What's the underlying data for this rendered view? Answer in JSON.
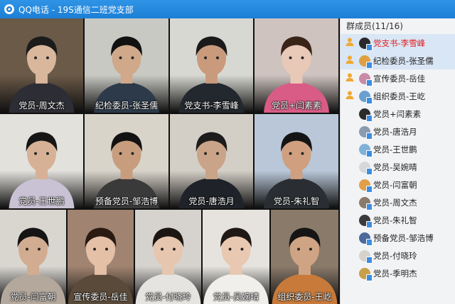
{
  "window": {
    "app": "QQ电话",
    "separator": "-",
    "group": "19S通信二班党支部"
  },
  "video_tiles": [
    {
      "label": "党员-周文杰",
      "bg": "#6b5a48",
      "skin": "#d9b79c",
      "hair": "#1b1b1b",
      "shirt": "#2d2d35"
    },
    {
      "label": "纪检委员-张圣儒",
      "bg": "#c9c9c4",
      "skin": "#cfa98a",
      "hair": "#111111",
      "shirt": "#2c3a4a"
    },
    {
      "label": "党支书-李雪峰",
      "bg": "#d8d8d2",
      "skin": "#c99a7c",
      "hair": "#1a1a1a",
      "shirt": "#23282e"
    },
    {
      "label": "党员+闫素素",
      "bg": "#cfc3bf",
      "skin": "#e8c9b8",
      "hair": "#3a2418",
      "shirt": "#d85c86"
    },
    {
      "label": "党员-王世鹏",
      "bg": "#e3e1dc",
      "skin": "#d6b196",
      "hair": "#161616",
      "shirt": "#c9c2d4"
    },
    {
      "label": "预备党员-邹浩博",
      "bg": "#d9d4ca",
      "skin": "#c79d7d",
      "hair": "#121212",
      "shirt": "#3a3a3a"
    },
    {
      "label": "党员-唐浩月",
      "bg": "#d4cfc6",
      "skin": "#caa488",
      "hair": "#1c1c1c",
      "shirt": "#1f2228"
    },
    {
      "label": "党员-朱礼智",
      "bg": "#b9c7d8",
      "skin": "#cf9f7f",
      "hair": "#141414",
      "shirt": "#2a2e33"
    },
    {
      "label": "党员-闫富朝",
      "bg": "#d9d6d0",
      "skin": "#d2ac90",
      "hair": "#151515",
      "shirt": "#b4a89c"
    },
    {
      "label": "宣传委员-岳佳",
      "bg": "#a08370",
      "skin": "#e3c0a6",
      "hair": "#2a1a12",
      "shirt": "#5a4a3a"
    },
    {
      "label": "党员-付晓玲",
      "bg": "#d6d3cf",
      "skin": "#e6c6ae",
      "hair": "#1c1612",
      "shirt": "#e6e4e0"
    },
    {
      "label": "党员-吴婉晴",
      "bg": "#e6e3de",
      "skin": "#e8c8b0",
      "hair": "#1f1814",
      "shirt": "#f1efeb"
    },
    {
      "label": "组织委员-王屹",
      "bg": "#8a7a6a",
      "skin": "#cfa484",
      "hair": "#151515",
      "shirt": "#c77a3a"
    }
  ],
  "members_panel": {
    "title": "群成员(11/16)",
    "members": [
      {
        "label": "党支书-李雪峰",
        "role_icon": "admin-icon",
        "avatar_color": "#2a2a2a",
        "leader": true,
        "selected": true
      },
      {
        "label": "纪检委员-张圣儒",
        "role_icon": "admin-icon",
        "avatar_color": "#e0a040",
        "leader": false,
        "selected": true
      },
      {
        "label": "宣传委员-岳佳",
        "role_icon": "admin-icon",
        "avatar_color": "#c98aa8",
        "leader": false,
        "selected": false
      },
      {
        "label": "组织委员-王屹",
        "role_icon": "admin-icon",
        "avatar_color": "#6aa0d0",
        "leader": false,
        "selected": false
      },
      {
        "label": "党员+闫素素",
        "role_icon": "",
        "avatar_color": "#2b2b2b",
        "leader": false,
        "selected": false
      },
      {
        "label": "党员-唐浩月",
        "role_icon": "",
        "avatar_color": "#8a9bb0",
        "leader": false,
        "selected": false
      },
      {
        "label": "党员-王世鹏",
        "role_icon": "",
        "avatar_color": "#7fb2d8",
        "leader": false,
        "selected": false
      },
      {
        "label": "党员-吴婉晴",
        "role_icon": "",
        "avatar_color": "#d8d8d8",
        "leader": false,
        "selected": false
      },
      {
        "label": "党员-闫富朝",
        "role_icon": "",
        "avatar_color": "#e0a048",
        "leader": false,
        "selected": false
      },
      {
        "label": "党员-周文杰",
        "role_icon": "",
        "avatar_color": "#8a7a6a",
        "leader": false,
        "selected": false
      },
      {
        "label": "党员-朱礼智",
        "role_icon": "",
        "avatar_color": "#3a3a3a",
        "leader": false,
        "selected": false
      },
      {
        "label": "预备党员-邹浩博",
        "role_icon": "",
        "avatar_color": "#4a6a9a",
        "leader": false,
        "selected": false
      },
      {
        "label": "党员-付晓玲",
        "role_icon": "",
        "avatar_color": "#d8d2cc",
        "leader": false,
        "selected": false
      },
      {
        "label": "党员-季明杰",
        "role_icon": "",
        "avatar_color": "#c8a048",
        "leader": false,
        "selected": false
      }
    ]
  },
  "colors": {
    "titlebar": "#1c7fd6",
    "leader_text": "#e02020",
    "selected_row": "#d9e6f5"
  }
}
